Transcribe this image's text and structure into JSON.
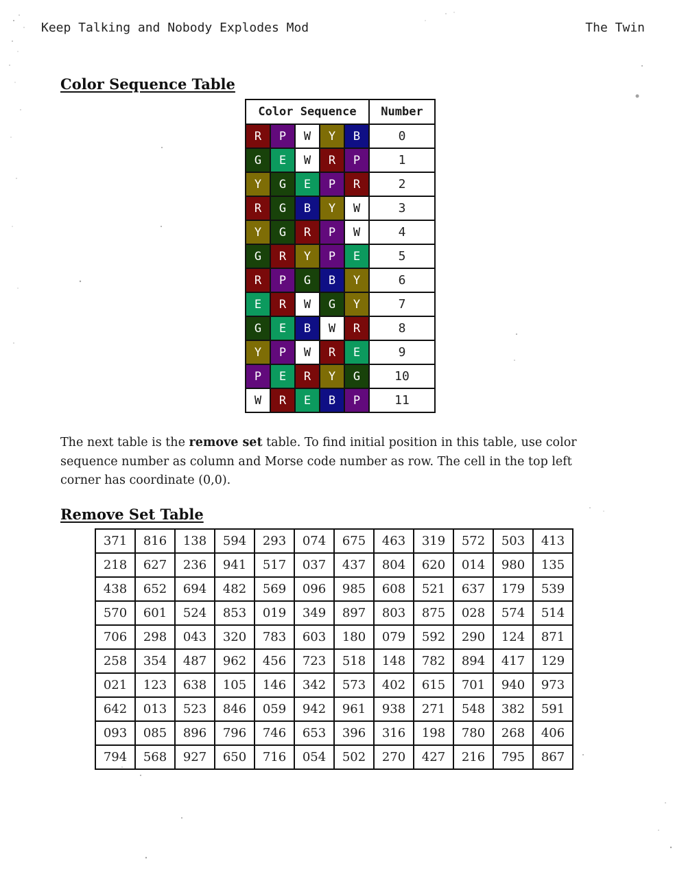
{
  "header": {
    "left": "Keep Talking and Nobody Explodes Mod",
    "right": "The Twin"
  },
  "color_section": {
    "heading": "Color Sequence Table",
    "col_sequence": "Color Sequence",
    "col_number": "Number",
    "colors": {
      "R": "#7a0a0a",
      "P": "#620a7c",
      "W": "#ffffff",
      "Y": "#7e6d06",
      "B": "#0f0f85",
      "G": "#18420a",
      "E": "#0c9a5e"
    },
    "rows": [
      {
        "seq": [
          "R",
          "P",
          "W",
          "Y",
          "B"
        ],
        "number": "0"
      },
      {
        "seq": [
          "G",
          "E",
          "W",
          "R",
          "P"
        ],
        "number": "1"
      },
      {
        "seq": [
          "Y",
          "G",
          "E",
          "P",
          "R"
        ],
        "number": "2"
      },
      {
        "seq": [
          "R",
          "G",
          "B",
          "Y",
          "W"
        ],
        "number": "3"
      },
      {
        "seq": [
          "Y",
          "G",
          "R",
          "P",
          "W"
        ],
        "number": "4"
      },
      {
        "seq": [
          "G",
          "R",
          "Y",
          "P",
          "E"
        ],
        "number": "5"
      },
      {
        "seq": [
          "R",
          "P",
          "G",
          "B",
          "Y"
        ],
        "number": "6"
      },
      {
        "seq": [
          "E",
          "R",
          "W",
          "G",
          "Y"
        ],
        "number": "7"
      },
      {
        "seq": [
          "G",
          "E",
          "B",
          "W",
          "R"
        ],
        "number": "8"
      },
      {
        "seq": [
          "Y",
          "P",
          "W",
          "R",
          "E"
        ],
        "number": "9"
      },
      {
        "seq": [
          "P",
          "E",
          "R",
          "Y",
          "G"
        ],
        "number": "10"
      },
      {
        "seq": [
          "W",
          "R",
          "E",
          "B",
          "P"
        ],
        "number": "11"
      }
    ]
  },
  "paragraph": {
    "before": "The next table is the ",
    "bold": "remove set",
    "after": " table. To find initial position in this table, use color sequence number as column and Morse code number as row. The cell in the top left corner has coordinate (0,0)."
  },
  "remove_section": {
    "heading": "Remove Set Table",
    "rows": [
      [
        "371",
        "816",
        "138",
        "594",
        "293",
        "074",
        "675",
        "463",
        "319",
        "572",
        "503",
        "413"
      ],
      [
        "218",
        "627",
        "236",
        "941",
        "517",
        "037",
        "437",
        "804",
        "620",
        "014",
        "980",
        "135"
      ],
      [
        "438",
        "652",
        "694",
        "482",
        "569",
        "096",
        "985",
        "608",
        "521",
        "637",
        "179",
        "539"
      ],
      [
        "570",
        "601",
        "524",
        "853",
        "019",
        "349",
        "897",
        "803",
        "875",
        "028",
        "574",
        "514"
      ],
      [
        "706",
        "298",
        "043",
        "320",
        "783",
        "603",
        "180",
        "079",
        "592",
        "290",
        "124",
        "871"
      ],
      [
        "258",
        "354",
        "487",
        "962",
        "456",
        "723",
        "518",
        "148",
        "782",
        "894",
        "417",
        "129"
      ],
      [
        "021",
        "123",
        "638",
        "105",
        "146",
        "342",
        "573",
        "402",
        "615",
        "701",
        "940",
        "973"
      ],
      [
        "642",
        "013",
        "523",
        "846",
        "059",
        "942",
        "961",
        "938",
        "271",
        "548",
        "382",
        "591"
      ],
      [
        "093",
        "085",
        "896",
        "796",
        "746",
        "653",
        "396",
        "316",
        "198",
        "780",
        "268",
        "406"
      ],
      [
        "794",
        "568",
        "927",
        "650",
        "716",
        "054",
        "502",
        "270",
        "427",
        "216",
        "795",
        "867"
      ]
    ]
  }
}
